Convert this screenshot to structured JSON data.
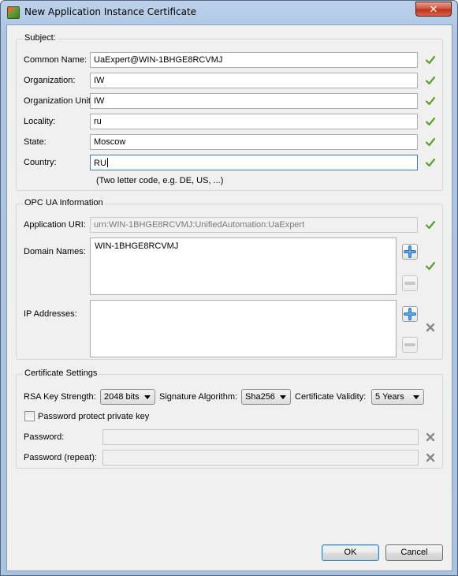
{
  "window": {
    "title": "New Application Instance Certificate",
    "close_glyph": "✕"
  },
  "subject": {
    "group_title": "Subject:",
    "common_name": {
      "label": "Common Name:",
      "value": "UaExpert@WIN-1BHGE8RCVMJ"
    },
    "organization": {
      "label": "Organization:",
      "value": "IW"
    },
    "organization_unit": {
      "label": "Organization Unit:",
      "value": "IW"
    },
    "locality": {
      "label": "Locality:",
      "value": "ru"
    },
    "state": {
      "label": "State:",
      "value": "Moscow"
    },
    "country": {
      "label": "Country:",
      "value": "RU"
    },
    "country_hint": "(Two letter code, e.g. DE, US, ...)"
  },
  "opcua": {
    "group_title": "OPC UA Information",
    "application_uri": {
      "label": "Application URI:",
      "value": "urn:WIN-1BHGE8RCVMJ:UnifiedAutomation:UaExpert"
    },
    "domain_names": {
      "label": "Domain Names:",
      "value": "WIN-1BHGE8RCVMJ"
    },
    "ip_addresses": {
      "label": "IP Addresses:",
      "value": ""
    }
  },
  "cert": {
    "group_title": "Certificate Settings",
    "rsa_label": "RSA Key Strength:",
    "rsa_value": "2048 bits",
    "sig_label": "Signature Algorithm:",
    "sig_value": "Sha256",
    "validity_label": "Certificate Validity:",
    "validity_value": "5 Years",
    "password_protect_label": "Password protect private key",
    "password_protect_checked": false,
    "password_label": "Password:",
    "password_repeat_label": "Password (repeat):"
  },
  "buttons": {
    "ok": "OK",
    "cancel": "Cancel"
  },
  "colors": {
    "valid_check": "#5aa02c",
    "invalid_x": "#8a8a8a",
    "plus_blue": "#2a78c2"
  },
  "icons": {
    "valid": "check-icon",
    "invalid": "x-icon",
    "add": "plus-icon",
    "remove": "minus-icon"
  }
}
